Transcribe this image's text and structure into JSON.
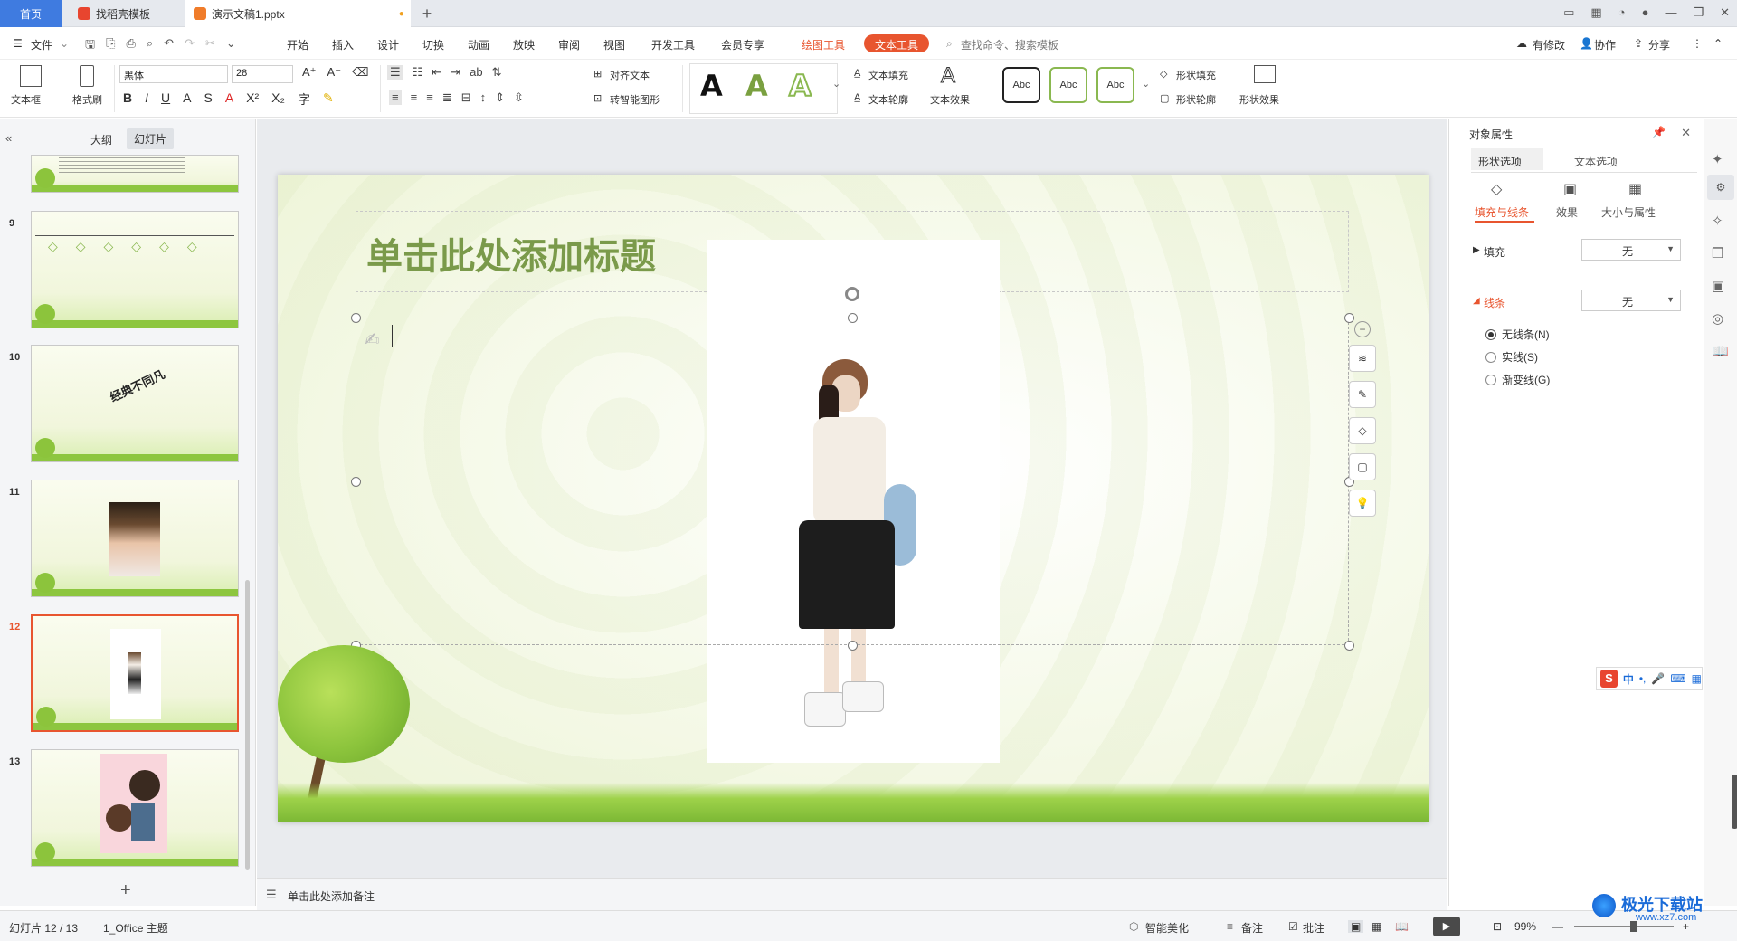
{
  "tabs": {
    "home": "首页",
    "daoke": "找稻壳模板",
    "doc": "演示文稿1.pptx",
    "add": "+"
  },
  "menu": {
    "file": "文件",
    "items": [
      "开始",
      "插入",
      "设计",
      "切换",
      "动画",
      "放映",
      "审阅",
      "视图",
      "开发工具",
      "会员专享"
    ],
    "drawing_tools": "绘图工具",
    "text_tools": "文本工具",
    "search_placeholder": "查找命令、搜索模板",
    "right": {
      "changes": "有修改",
      "collab": "协作",
      "share": "分享"
    }
  },
  "ribbon": {
    "textbox": "文本框",
    "format_painter": "格式刷",
    "font_name": "黑体",
    "font_size": "28",
    "align_text": "对齐文本",
    "smart_shape": "转智能图形",
    "text_fill": "文本填充",
    "text_outline": "文本轮廓",
    "text_effect": "文本效果",
    "abc": "Abc",
    "shape_fill": "形状填充",
    "shape_outline": "形状轮廓",
    "shape_effect": "形状效果",
    "big_a": "A"
  },
  "left_pane": {
    "tab_outline": "大纲",
    "tab_slides": "幻灯片",
    "thumbs": [
      {
        "num": "9"
      },
      {
        "num": "10",
        "text": "经典不同凡"
      },
      {
        "num": "11"
      },
      {
        "num": "12"
      },
      {
        "num": "13"
      }
    ],
    "selected": "12",
    "add": "+"
  },
  "slide": {
    "title_placeholder": "单击此处添加标题"
  },
  "notes_placeholder": "单击此处添加备注",
  "right_panel": {
    "title": "对象属性",
    "tab_shape": "形状选项",
    "tab_text": "文本选项",
    "sub_fill_line": "填充与线条",
    "sub_effect": "效果",
    "sub_size": "大小与属性",
    "fill_label": "填充",
    "fill_value": "无",
    "line_label": "线条",
    "line_value": "无",
    "radio": [
      "无线条(N)",
      "实线(S)",
      "渐变线(G)"
    ]
  },
  "ime": {
    "zh": "中"
  },
  "status": {
    "slide_info": "幻灯片 12 / 13",
    "theme": "1_Office 主题",
    "smart": "智能美化",
    "notes": "备注",
    "comment": "批注",
    "zoom": "99%"
  },
  "watermark": {
    "text": "极光下载站",
    "url": "www.xz7.com"
  },
  "colors": {
    "accent_blue": "#3f7be0",
    "text_tools_red": "#e8552f",
    "title_green": "#7a9a4a",
    "selected_border": "#e8552f"
  }
}
